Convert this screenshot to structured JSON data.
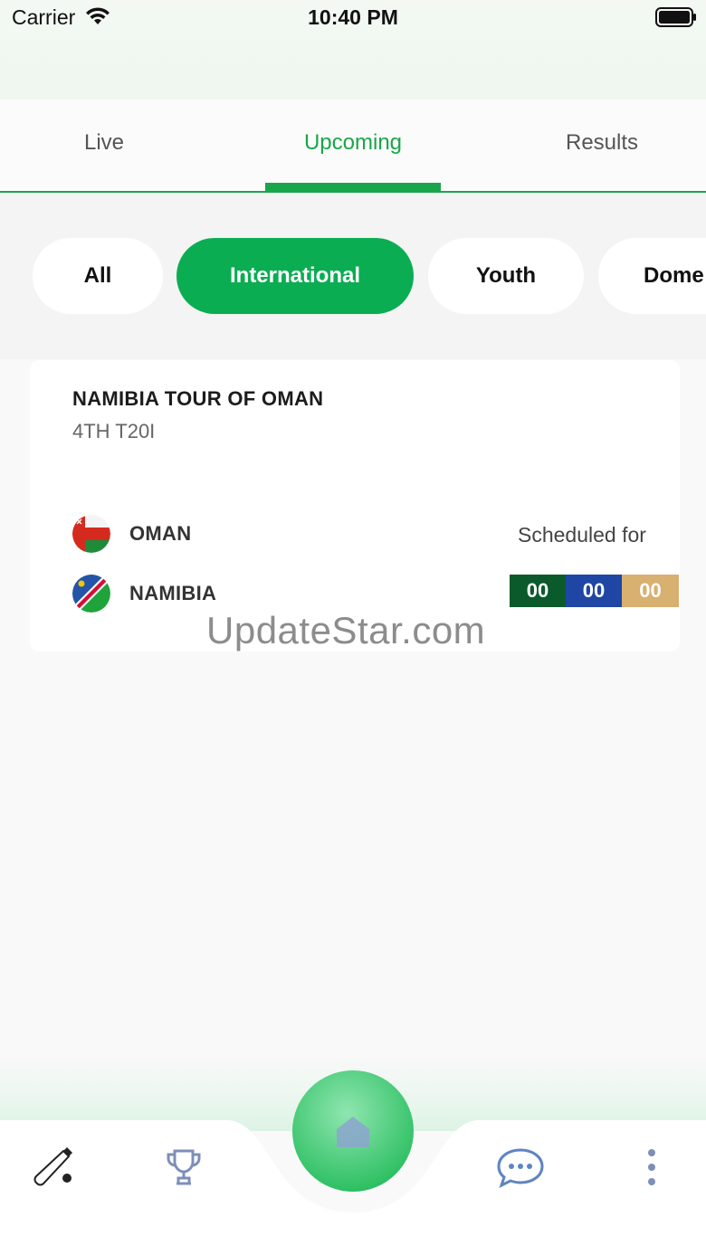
{
  "status_bar": {
    "carrier": "Carrier",
    "time": "10:40 PM",
    "wifi_icon": "wifi-icon",
    "battery_icon": "battery-icon"
  },
  "tabs": [
    {
      "label": "Live",
      "active": false
    },
    {
      "label": "Upcoming",
      "active": true
    },
    {
      "label": "Results",
      "active": false
    }
  ],
  "categories": [
    {
      "label": "All",
      "active": false
    },
    {
      "label": "International",
      "active": true
    },
    {
      "label": "Youth",
      "active": false
    },
    {
      "label": "Dome",
      "active": false
    }
  ],
  "match": {
    "series": "NAMIBIA TOUR OF OMAN",
    "subtitle": "4TH T20I",
    "team1": {
      "name": "OMAN",
      "flag_icon": "oman-flag-icon"
    },
    "team2": {
      "name": "NAMIBIA",
      "flag_icon": "namibia-flag-icon"
    },
    "status_label": "Scheduled for",
    "countdown": {
      "hours": "00",
      "minutes": "00",
      "seconds": "00"
    }
  },
  "watermark": "UpdateStar.com",
  "bottom_nav": {
    "items": [
      "cricket-bat-icon",
      "trophy-icon",
      "home-icon",
      "chat-icon",
      "more-icon"
    ]
  },
  "colors": {
    "accent": "#19a64a",
    "chip_active": "#0bad52",
    "countdown_hours": "#0b5a2c",
    "countdown_minutes": "#1f46a4",
    "countdown_seconds": "#d8b06f",
    "nav_icon": "#7d8fb8"
  }
}
